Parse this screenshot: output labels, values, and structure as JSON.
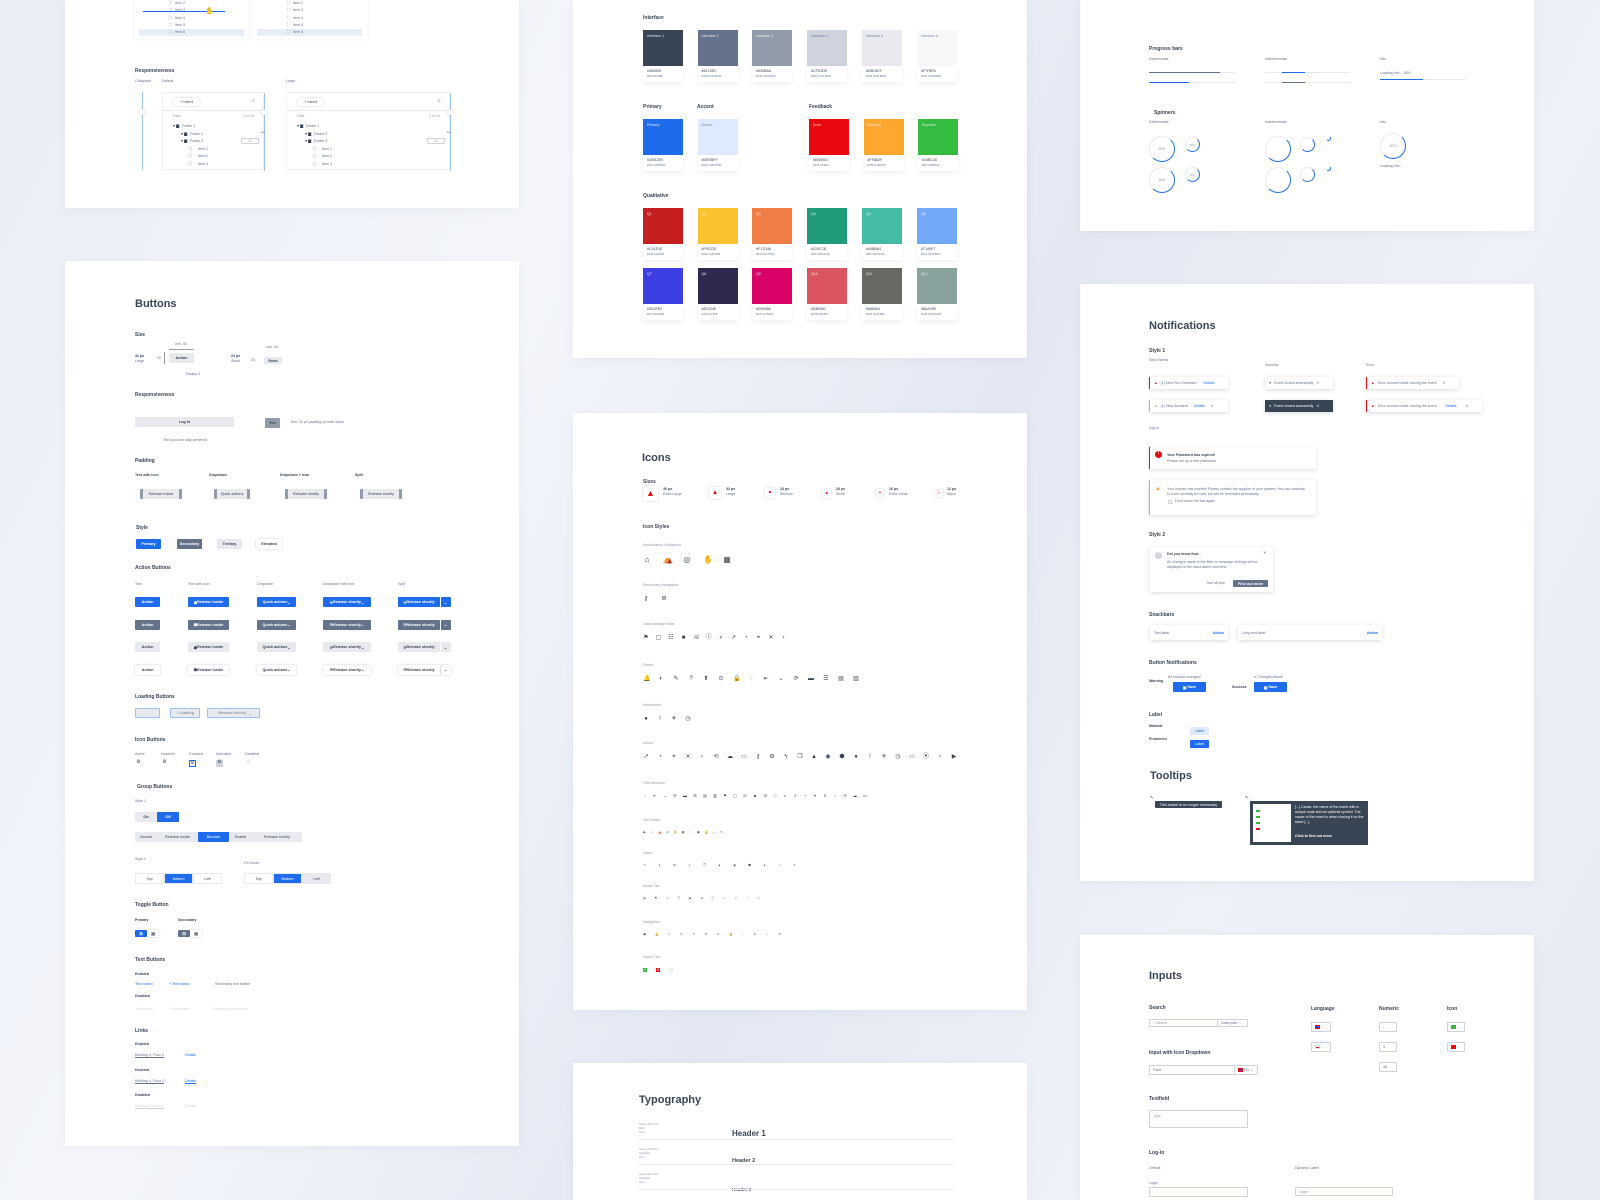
{
  "tree_panel": {
    "list_items": [
      "Item 2",
      "Item 3",
      "Item 4",
      "Item 5",
      "Item 6"
    ],
    "responsiveness": "Responsiveness",
    "collapsed": "Collapsed",
    "default": "Default",
    "large": "Large",
    "insert": "Insert",
    "files": "Files",
    "count": "1 of 19",
    "pager": "1",
    "tree": [
      "Folder 1",
      "Folder 2",
      "Folder 3",
      "Item 1",
      "Item 2",
      "Item 3"
    ]
  },
  "buttons": {
    "title": "Buttons",
    "size": {
      "heading": "Size",
      "large_px": "32 px",
      "large": "Large",
      "large_min": "min. 30",
      "large_h": "32",
      "action": "Action",
      "radius": "Radius 3",
      "small_px": "24 px",
      "small": "Small",
      "small_min": "min. 34",
      "small_h": "24",
      "redo": "Redo"
    },
    "responsiveness": {
      "heading": "Responsiveness",
      "login": "Log In",
      "centered_note": "Text and icon stay centered",
      "yes": "Yes",
      "padding_note": "Min. 32 px padding on both sides"
    },
    "padding": {
      "heading": "Padding",
      "labels": [
        "Text with icon",
        "Dropdown",
        "Dropdown + Icon",
        "Split"
      ],
      "buttons": [
        "Release inside",
        "Quick actions",
        "Release shortly",
        "Release shortly"
      ]
    },
    "style": {
      "heading": "Style",
      "items": [
        "Primary",
        "Secondary",
        "Tertiary",
        "Elevated"
      ]
    },
    "action": {
      "heading": "Action Buttons",
      "columns": [
        "Text",
        "Text with icon",
        "Dropdown",
        "Dropdown with icon",
        "Split"
      ],
      "labels": [
        "Action",
        "Release inside",
        "Quick actions",
        "Release shortly",
        "Release shortly"
      ]
    },
    "loading": {
      "heading": "Loading Buttons",
      "loading": "Loading",
      "release": "Release shortly"
    },
    "icon_buttons": {
      "heading": "Icon Buttons",
      "states": [
        "Active",
        "Hovered",
        "Focused",
        "Activated",
        "Disabled"
      ]
    },
    "group": {
      "heading": "Group Buttons",
      "style1": "Style 1",
      "on": "On",
      "off": "Off",
      "row": [
        "Normal",
        "Release inside",
        "Blocked",
        "Enable",
        "Release shortly"
      ],
      "style2": "Style 2",
      "on_hover": "On Hover",
      "tabs": [
        "Top",
        "Bottom",
        "Left"
      ]
    },
    "toggle": {
      "heading": "Toggle Button",
      "primary": "Primary",
      "secondary": "Secondary"
    },
    "text_buttons": {
      "heading": "Text Buttons",
      "enabled": "Enabled",
      "disabled": "Disabled",
      "items": [
        "Text button",
        "+ Text button",
        "Secondary text button"
      ]
    },
    "links": {
      "heading": "Links",
      "states": [
        "Enabled",
        "Hovered",
        "Disabled"
      ],
      "location": "Building 4, Floor 2",
      "details": "Details"
    }
  },
  "colors": {
    "interface_heading": "Interface",
    "interface": [
      {
        "name": "Interface 1",
        "hex": "#384555",
        "rgb": "R56 G69 B85"
      },
      {
        "name": "Interface 2",
        "hex": "#64728C",
        "rgb": "R100 G114 B140"
      },
      {
        "name": "Interface 3",
        "hex": "#929BAA",
        "rgb": "R146 G155 B170"
      },
      {
        "name": "Interface 4",
        "hex": "#CFD3DE",
        "rgb": "R207 G211 B222"
      },
      {
        "name": "Interface 5",
        "hex": "#E8EAEF",
        "rgb": "R232 G234 B239"
      },
      {
        "name": "Interface 6",
        "hex": "#F7F8FA",
        "rgb": "R247 G248 B250"
      }
    ],
    "primary_heading": "Primary",
    "accent_heading": "Accent",
    "feedback_heading": "Feedback",
    "primary": {
      "name": "Primary",
      "hex": "#1E6CEB",
      "rgb": "R30 G108 B235"
    },
    "accent": {
      "name": "Accent",
      "hex": "#DEEBFF",
      "rgb": "R222 G235 B255"
    },
    "feedback": [
      {
        "name": "Error",
        "hex": "#EB0910",
        "rgb": "R235 G9 B16"
      },
      {
        "name": "Warning",
        "hex": "#FFA62F",
        "rgb": "R255 G166 B47"
      },
      {
        "name": "Success",
        "hex": "#34BC40",
        "rgb": "R52 G188 B64"
      }
    ],
    "qualitative_heading": "Qualitative",
    "qualitative": [
      {
        "name": "Q1",
        "hex": "#C41E1E",
        "rgb": "R196 G30 B30"
      },
      {
        "name": "Q2",
        "hex": "#F9C22E",
        "rgb": "R249 G194 B46"
      },
      {
        "name": "Q3",
        "hex": "#F17D46",
        "rgb": "R241 G125 B70"
      },
      {
        "name": "Q4",
        "hex": "#219C7B",
        "rgb": "R33 G156 B123"
      },
      {
        "name": "Q5",
        "hex": "#44BBA4",
        "rgb": "R68 G187 B164"
      },
      {
        "name": "Q6",
        "hex": "#71A9F7",
        "rgb": "R113 G169 B247"
      },
      {
        "name": "Q7",
        "hex": "#3D3FE2",
        "rgb": "R61 G63 B226"
      },
      {
        "name": "Q8",
        "hex": "#2E294E",
        "rgb": "R46 G41 B78"
      },
      {
        "name": "Q9",
        "hex": "#D90368",
        "rgb": "R217 G3 B104"
      },
      {
        "name": "Q10",
        "hex": "#DB5461",
        "rgb": "R219 G84 B97"
      },
      {
        "name": "Q11",
        "hex": "#686963",
        "rgb": "R104 G105 B99"
      },
      {
        "name": "Q12",
        "hex": "#8AA29E",
        "rgb": "R138 G162 B158"
      }
    ]
  },
  "icons": {
    "title": "Icons",
    "sizes_heading": "Sizes",
    "sizes": [
      {
        "px": "40 px",
        "name": "Extra Large"
      },
      {
        "px": "32 px",
        "name": "Large"
      },
      {
        "px": "24 px",
        "name": "Medium"
      },
      {
        "px": "20 px",
        "name": "Small"
      },
      {
        "px": "16 px",
        "name": "Extra Small"
      },
      {
        "px": "12 px",
        "name": "Micro"
      }
    ],
    "styles_heading": "Icon Styles",
    "groups": [
      {
        "label": "Visualization Navigation",
        "icons": [
          "home-settings",
          "cloud-download",
          "battery",
          "campfire",
          "laptop"
        ]
      },
      {
        "label": "Secondary Navigation",
        "icons": [
          "menu",
          "lifebuoy"
        ]
      },
      {
        "label": "Data Manager Tabs",
        "icons": [
          "key",
          "printer",
          "hand",
          "gear",
          "book",
          "document",
          "lightning",
          "flag",
          "arrow-up",
          "copy",
          "screen",
          "monitor"
        ]
      },
      {
        "label": "Object",
        "icons": [
          "fire",
          "wrench",
          "warning",
          "sliders",
          "bell",
          "target",
          "camera",
          "presentation",
          "globe",
          "shield",
          "phone",
          "tool",
          "extinguisher",
          "person-settings",
          "people"
        ]
      },
      {
        "label": "Information",
        "icons": [
          "info",
          "info-circle",
          "question",
          "alert"
        ]
      },
      {
        "label": "Action",
        "icons": [
          "inbox",
          "filter",
          "print",
          "search",
          "settings",
          "plane",
          "external-link",
          "copy",
          "wifi",
          "pin",
          "timer",
          "signal",
          "circle",
          "lock",
          "server",
          "computer",
          "location",
          "clock",
          "eye",
          "eye-off",
          "history",
          "save",
          "lock-open"
        ]
      },
      {
        "label": "Tree structure",
        "icons": [
          "folder",
          "folder-open",
          "folder-closed",
          "link",
          "camera",
          "grid",
          "shield",
          "square",
          "target",
          "circle",
          "chain",
          "clock",
          "user",
          "crosshair",
          "phone",
          "person",
          "chat",
          "gear",
          "triangle",
          "tablet",
          "wifi",
          "redo",
          "frame"
        ]
      },
      {
        "label": "Text Editor",
        "icons": [
          "bold",
          "italic",
          "underline",
          "list",
          "numbered-list",
          "align",
          "pen",
          "image",
          "color",
          "link",
          "table"
        ]
      },
      {
        "label": "Video",
        "icons": [
          "play",
          "rewind",
          "forward",
          "calendar",
          "refresh",
          "minus",
          "plane",
          "gear",
          "camera",
          "lock",
          "fullscreen"
        ]
      },
      {
        "label": "Modal Tab",
        "icons": [
          "list",
          "clock",
          "link",
          "filter",
          "upload",
          "screen",
          "video",
          "edit",
          "edit",
          "lock",
          "globe"
        ]
      },
      {
        "label": "Navigation",
        "icons": [
          "first",
          "previous",
          "left",
          "right",
          "chevron-left",
          "chevron-right",
          "chevron-down",
          "chevron-up",
          "caret",
          "dot",
          "more",
          "close"
        ]
      },
      {
        "label": "Action List",
        "icons": [
          "check",
          "close",
          "empty",
          "dot"
        ]
      }
    ]
  },
  "typography": {
    "title": "Typography",
    "rows": [
      {
        "font": "Source Sans Pro",
        "weight": "Bold",
        "size": "32 pt",
        "sample": "Header 1"
      },
      {
        "font": "Source Sans Pro",
        "weight": "Semibold",
        "size": "24 pt",
        "sample": "Header 2"
      },
      {
        "font": "Source Sans Pro",
        "weight": "Semibold",
        "size": "18 pt",
        "sample": "Header 3"
      }
    ]
  },
  "progress": {
    "bars_heading": "Progress bars",
    "spinners_heading": "Spinners",
    "determinate": "Determinate",
    "indeterminate": "Indeterminate",
    "info": "Info",
    "determinate_values": [
      0.82,
      0.47
    ],
    "info_text": "Loading info... 50%",
    "info_value": 0.5,
    "spinner_label": "50%",
    "spinner_info": "Loading info..."
  },
  "notifications": {
    "title": "Notifications",
    "style1": "Style 1",
    "new_events": "New Events",
    "success": "Success",
    "error": "Error",
    "fire": "(1) New Fire Detection",
    "accident": "(1) New Accident",
    "details": "Details",
    "closed": "Event closed sucessfully",
    "error_msg": "Error occured while closing the event",
    "login": "Log In",
    "pw_title": "Your Password has expired!",
    "pw_body": "Please set up a new password",
    "license_body": "Your license has expired! Please contact the supplier of your system. You can continue to work normally for now, but will be reminded periodically.",
    "dont_show": "Don't show me this again",
    "style2": "Style 2",
    "tip_title": "Did you know that...",
    "tip_body": "All changes made to the filter or message settings will be displayed in the stack alarm overview.",
    "turn_off": "Turn off tips",
    "find_out": "Find out more",
    "snackbars": "Snackbars",
    "snack_short": "Text label",
    "snack_long": "Long text label",
    "snack_action": "Action",
    "button_notifications": "Button Notifications",
    "warning": "Warning",
    "unsaved": "Unsaved changes!",
    "saved": "Changes saved!",
    "save": "Save",
    "label_heading": "Label",
    "minimal": "Minimal",
    "prominent": "Prominent",
    "label": "Label",
    "tooltips": "Tooltips",
    "tooltip_simple": "This action is no longer necessary",
    "tooltip_rich": "[...] Cause: the name of the event with a unique code and an optional symbol. The cause of the event is when closing it on the stack [...]",
    "tooltip_link": "Click to find out more"
  },
  "inputs": {
    "title": "Inputs",
    "search": "Search",
    "search_placeholder": "Search",
    "data_point": "Data point",
    "language": "Language",
    "numeric": "Numeric",
    "icon": "Icon",
    "numeric_values": [
      "-",
      "1",
      "10"
    ],
    "icon_dropdown": "Input with Icon Dropdown",
    "fault": "Fault",
    "lang_code": "EN",
    "textfield": "Textfield",
    "type_placeholder": "Type",
    "login_heading": "Log-in",
    "default": "Default",
    "dynamic": "Dynamic Label",
    "login_label": "Login",
    "login_placeholder": "Login"
  }
}
